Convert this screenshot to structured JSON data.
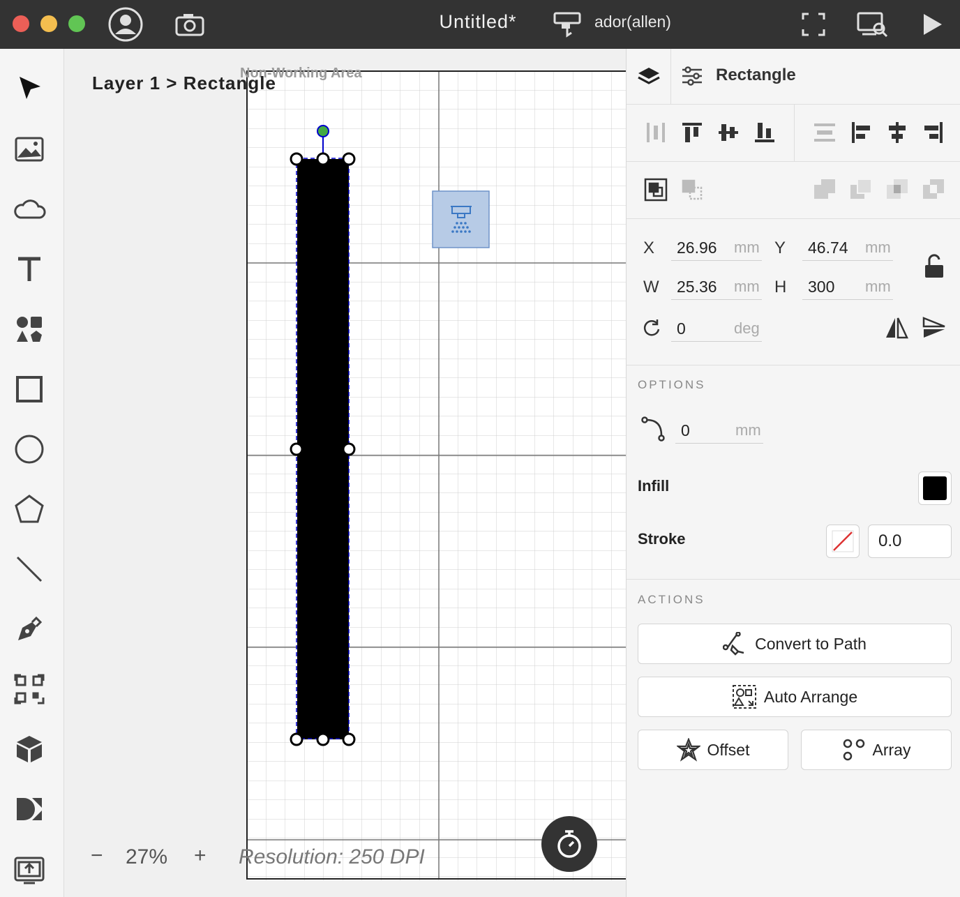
{
  "window": {
    "title": "Untitled*",
    "device_name": "ador(allen)"
  },
  "canvas": {
    "breadcrumb": "Layer 1 > Rectangle",
    "non_working_area": "Non-Working Area",
    "zoom_minus": "−",
    "zoom_value": "27%",
    "zoom_plus": "+",
    "resolution": "Resolution: 250 DPI"
  },
  "panel": {
    "object_title": "Rectangle",
    "x_label": "X",
    "x_value": "26.96",
    "x_unit": "mm",
    "y_label": "Y",
    "y_value": "46.74",
    "y_unit": "mm",
    "w_label": "W",
    "w_value": "25.36",
    "w_unit": "mm",
    "h_label": "H",
    "h_value": "300",
    "h_unit": "mm",
    "rot_value": "0",
    "rot_unit": "deg",
    "options_title": "OPTIONS",
    "corner_value": "0",
    "corner_unit": "mm",
    "infill_label": "Infill",
    "infill_color": "#000000",
    "stroke_label": "Stroke",
    "stroke_value": "0.0",
    "actions_title": "ACTIONS",
    "convert_label": "Convert to Path",
    "arrange_label": "Auto Arrange",
    "offset_label": "Offset",
    "array_label": "Array"
  },
  "colors": {
    "titlebar": "#333333",
    "close": "#ec5f57",
    "minimize": "#f4be4f",
    "maximize": "#61c554",
    "selection": "#0000cc",
    "rotate_handle": "#44aa44"
  }
}
